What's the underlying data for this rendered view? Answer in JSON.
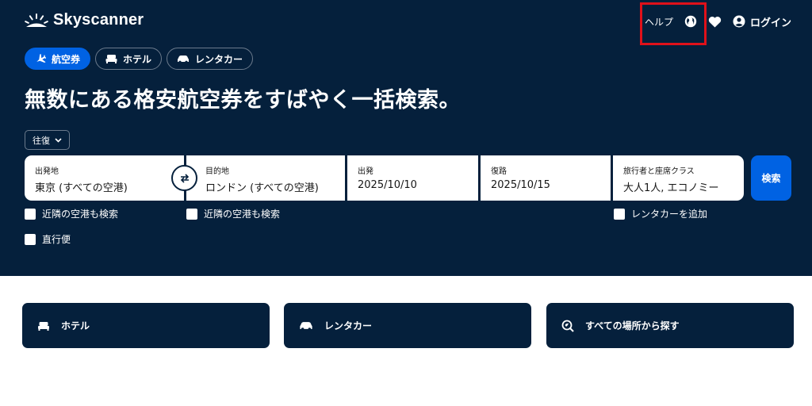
{
  "brand": {
    "name": "Skyscanner"
  },
  "topnav": {
    "help": "ヘルプ",
    "login": "ログイン"
  },
  "tabs": [
    {
      "label": "航空券",
      "icon": "plane-icon",
      "active": true
    },
    {
      "label": "ホテル",
      "icon": "bed-icon",
      "active": false
    },
    {
      "label": "レンタカー",
      "icon": "car-icon",
      "active": false
    }
  ],
  "headline": "無数にある格安航空券をすばやく一括検索。",
  "trip_type": "往復",
  "search": {
    "origin": {
      "label": "出発地",
      "value": "東京 (すべての空港)"
    },
    "destination": {
      "label": "目的地",
      "value": "ロンドン (すべての空港)"
    },
    "depart": {
      "label": "出発",
      "value": "2025/10/10"
    },
    "return": {
      "label": "復路",
      "value": "2025/10/15"
    },
    "travellers": {
      "label": "旅行者と座席クラス",
      "value": "大人1人, エコノミー"
    },
    "button": "検索"
  },
  "checkboxes": {
    "nearby_origin": "近隣の空港も検索",
    "nearby_destination": "近隣の空港も検索",
    "add_car": "レンタカーを追加",
    "direct": "直行便"
  },
  "cards": [
    {
      "label": "ホテル",
      "icon": "bed-icon"
    },
    {
      "label": "レンタカー",
      "icon": "car-icon"
    },
    {
      "label": "すべての場所から探す",
      "icon": "explore-icon"
    }
  ],
  "colors": {
    "hero_bg": "#05203c",
    "accent": "#0062e3",
    "highlight": "#e0111a"
  }
}
